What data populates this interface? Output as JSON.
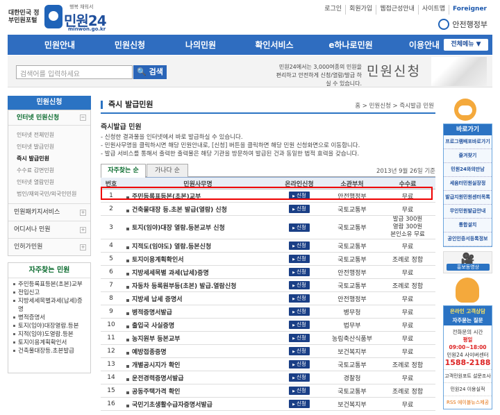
{
  "header": {
    "logo_text": "대한민국 정부민원포털",
    "logo_tagline": "행복 채워서",
    "logo_name": "민원24",
    "logo_url": "minwon.go.kr",
    "top_links": [
      "로그인",
      "회원가입",
      "웹접근성안내",
      "사이트맵",
      "Foreigner"
    ],
    "ministry": "안전행정부"
  },
  "nav": {
    "items": [
      "민원안내",
      "민원신청",
      "나의민원",
      "확인서비스",
      "e하나로민원",
      "이용안내"
    ],
    "full_menu": "전체메뉴 ▼"
  },
  "search": {
    "placeholder": "검색어를 입력하세요",
    "button": "검색"
  },
  "promo": {
    "line1": "민원24에서는 3,000여종의 민원을",
    "line2": "편리하고 안전하게 신청/열람/발급 하실 수 있습니다.",
    "title": "민원신청"
  },
  "left": {
    "header": "민원신청",
    "sub": "인터넷 민원신청",
    "items": [
      "인터넷 전체민원",
      "인터넷 발급민원",
      "즉시 발급민원",
      "수수료 감면민원",
      "인터넷 열람민원",
      "법인/재외국민/외국인민원"
    ],
    "active_index": 2,
    "sections": [
      "민원패키지서비스",
      "어디서나 민원",
      "인허가민원"
    ],
    "fav_header": "자주찾는 민원",
    "fav_items": [
      "주민등록표등본(초본)교부",
      "전입신고",
      "지방세세목별과세(납세)증명",
      "병적증명서",
      "토지(임야)대장열람.등본",
      "지적(임야)도열람.등본",
      "토지이용계획확인서",
      "건축물대장등.초본발급"
    ]
  },
  "main": {
    "title": "즉시 발급민원",
    "breadcrumb": "홈 > 민원신청 > 즉시발급 민원",
    "section_title": "즉시발급 민원",
    "desc": [
      "- 신청한 결과물을 인터넷에서 바로 발급하실 수 있습니다.",
      "- 민원사무명을 클릭하시면 해당 민원안내로, [신청] 버튼을 클릭하면 해당 민원 신청화면으로 이동합니다.",
      "- 발급 서비스를 통해서 출력한 출력물은 해당 기관을 방문하여 발급된 건과 동일한 법적 효력을 갖습니다."
    ],
    "tabs": [
      "자주찾는 순",
      "가나다 순"
    ],
    "date": "2013년 9월 26일 기준",
    "columns": [
      "번호",
      "민원사무명",
      "온라인신청",
      "소관부처",
      "수수료"
    ],
    "apply_label": "신청",
    "rows": [
      {
        "no": "1",
        "name": "주민등록표등본(초본)교부",
        "dept": "안전행정부",
        "fee": [
          "무료"
        ]
      },
      {
        "no": "2",
        "name": "건축물대장 등.초본 발급(열람) 신청",
        "dept": "국토교통부",
        "fee": [
          "무료"
        ]
      },
      {
        "no": "3",
        "name": "토지(임야)대장 열람.등본교부 신청",
        "dept": "국토교통부",
        "fee": [
          "발급 300원",
          "열람 300원",
          "본인소유 무료"
        ]
      },
      {
        "no": "4",
        "name": "지적도(임야도) 열람.등본신청",
        "dept": "국토교통부",
        "fee": [
          "무료"
        ]
      },
      {
        "no": "5",
        "name": "토지이용계획확인서",
        "dept": "국토교통부",
        "fee": [
          "조례로 정함"
        ]
      },
      {
        "no": "6",
        "name": "지방세세목별 과세(납세)증명",
        "dept": "안전행정부",
        "fee": [
          "무료"
        ]
      },
      {
        "no": "7",
        "name": "자동차 등록원부등(초본) 발급.열람신청",
        "dept": "국토교통부",
        "fee": [
          "조례로 정함"
        ]
      },
      {
        "no": "8",
        "name": "지방세 납세 증명서",
        "dept": "안전행정부",
        "fee": [
          "무료"
        ]
      },
      {
        "no": "9",
        "name": "병적증명서발급",
        "dept": "병무청",
        "fee": [
          "무료"
        ]
      },
      {
        "no": "10",
        "name": "출입국 사실증명",
        "dept": "법무부",
        "fee": [
          "무료"
        ]
      },
      {
        "no": "11",
        "name": "농지원부 등본교부",
        "dept": "농림축산식품부",
        "fee": [
          "무료"
        ]
      },
      {
        "no": "12",
        "name": "예방접종증명",
        "dept": "보건복지부",
        "fee": [
          "무료"
        ]
      },
      {
        "no": "13",
        "name": "개별공시지가 확인",
        "dept": "국토교통부",
        "fee": [
          "조례로 정함"
        ]
      },
      {
        "no": "14",
        "name": "운전경력증명서발급",
        "dept": "경찰청",
        "fee": [
          "무료"
        ]
      },
      {
        "no": "15",
        "name": "공동주택가격 확인",
        "dept": "국토교통부",
        "fee": [
          "조례로 정함"
        ]
      },
      {
        "no": "16",
        "name": "국민기초생활수급자증명서발급",
        "dept": "보건복지부",
        "fee": [
          "무료"
        ]
      }
    ]
  },
  "right": {
    "quick_header": "바로가기",
    "quick_items": [
      "프로그램배포바로가기",
      "즐겨찾기",
      "민원24와의만남",
      "세움터민원실장정",
      "발급지원민원센터목록",
      "무인민원발급안내",
      "통합설치",
      "공인인증서등록정보"
    ],
    "video_label": "홍보동영상",
    "center_l1": "온라인 고객상담",
    "center_l2": "자주묻는 질문",
    "center_info_l1": "전화문의 시간",
    "center_info_l2": "평일 09:00~18:00",
    "center_info_l3": "민원24 사이버센터",
    "center_phone": "1588-2188",
    "list": [
      "고객민원포트 설문조사",
      "민원24 이용실적",
      "RSS 에이블뉴스제공"
    ]
  }
}
